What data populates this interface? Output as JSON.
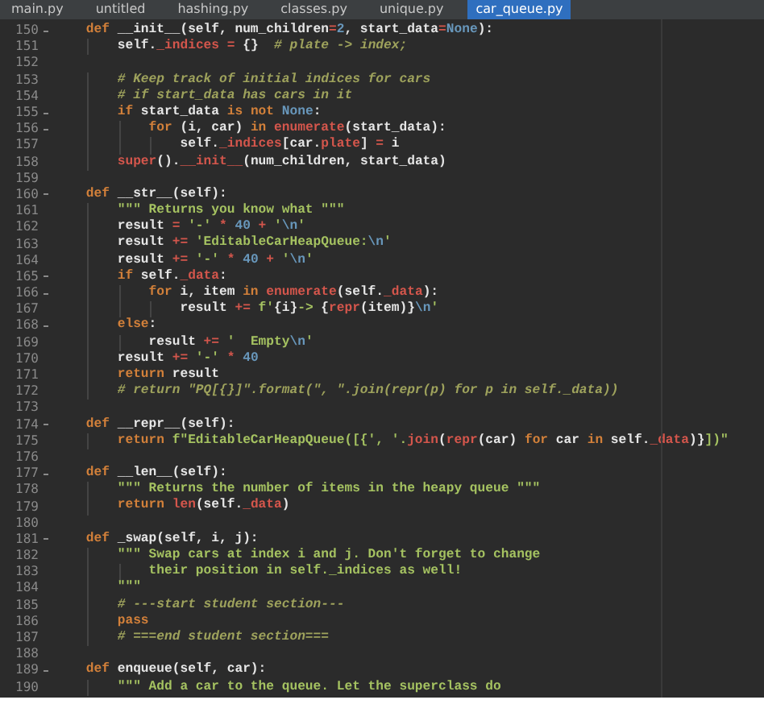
{
  "tabs": [
    {
      "label": "main.py",
      "selected": false
    },
    {
      "label": "untitled",
      "selected": false
    },
    {
      "label": "hashing.py",
      "selected": false
    },
    {
      "label": "classes.py",
      "selected": false
    },
    {
      "label": "unique.py",
      "selected": false
    },
    {
      "label": "car_queue.py",
      "selected": true
    }
  ],
  "lines": [
    {
      "n": "150",
      "fold": true,
      "tokens": [
        {
          "kind": "keyword",
          "text": "    def"
        },
        {
          "kind": "plain",
          "text": " __init__(self, num_children"
        },
        {
          "kind": "builtin",
          "text": "="
        },
        {
          "kind": "number",
          "text": "2"
        },
        {
          "kind": "plain",
          "text": ", start_data"
        },
        {
          "kind": "builtin",
          "text": "="
        },
        {
          "kind": "number",
          "text": "None"
        },
        {
          "kind": "plain",
          "text": "):"
        }
      ]
    },
    {
      "n": "151",
      "fold": false,
      "tokens": [
        {
          "kind": "plain",
          "text": "        self."
        },
        {
          "kind": "builtin",
          "text": "_indices = "
        },
        {
          "kind": "plain",
          "text": "{}  "
        },
        {
          "kind": "comment",
          "text": "# plate -> index;"
        }
      ]
    },
    {
      "n": "152",
      "fold": false
    },
    {
      "n": "153",
      "fold": false,
      "tokens": [
        {
          "kind": "comment",
          "text": "        # Keep track of initial indices for cars"
        }
      ]
    },
    {
      "n": "154",
      "fold": false,
      "tokens": [
        {
          "kind": "comment",
          "text": "        # if start_data has cars in it"
        }
      ]
    },
    {
      "n": "155",
      "fold": true,
      "tokens": [
        {
          "kind": "keyword",
          "text": "        if"
        },
        {
          "kind": "plain",
          "text": " start_data "
        },
        {
          "kind": "keyword",
          "text": "is not"
        },
        {
          "kind": "number",
          "text": " None"
        },
        {
          "kind": "plain",
          "text": ":"
        }
      ]
    },
    {
      "n": "156",
      "fold": true,
      "tokens": [
        {
          "kind": "keyword",
          "text": "            for"
        },
        {
          "kind": "plain",
          "text": " (i, car) "
        },
        {
          "kind": "keyword",
          "text": "in"
        },
        {
          "kind": "builtin",
          "text": " enumerate"
        },
        {
          "kind": "plain",
          "text": "(start_data):"
        }
      ]
    },
    {
      "n": "157",
      "fold": false,
      "tokens": [
        {
          "kind": "plain",
          "text": "                self."
        },
        {
          "kind": "builtin",
          "text": "_indices"
        },
        {
          "kind": "plain",
          "text": "[car."
        },
        {
          "kind": "builtin",
          "text": "plate"
        },
        {
          "kind": "plain",
          "text": "] "
        },
        {
          "kind": "builtin",
          "text": "="
        },
        {
          "kind": "plain",
          "text": " i"
        }
      ]
    },
    {
      "n": "158",
      "fold": false,
      "tokens": [
        {
          "kind": "builtin",
          "text": "        super"
        },
        {
          "kind": "plain",
          "text": "()."
        },
        {
          "kind": "builtin",
          "text": "__init__"
        },
        {
          "kind": "plain",
          "text": "(num_children, start_data)"
        }
      ]
    },
    {
      "n": "159",
      "fold": false
    },
    {
      "n": "160",
      "fold": true,
      "tokens": [
        {
          "kind": "keyword",
          "text": "    def"
        },
        {
          "kind": "plain",
          "text": " __str__(self):"
        }
      ]
    },
    {
      "n": "161",
      "fold": false,
      "tokens": [
        {
          "kind": "string",
          "text": "        \"\"\" Returns you know what \"\"\""
        }
      ]
    },
    {
      "n": "162",
      "fold": false,
      "tokens": [
        {
          "kind": "plain",
          "text": "        result "
        },
        {
          "kind": "builtin",
          "text": "="
        },
        {
          "kind": "string",
          "text": " '-'"
        },
        {
          "kind": "builtin",
          "text": " *"
        },
        {
          "kind": "number",
          "text": " 40"
        },
        {
          "kind": "builtin",
          "text": " +"
        },
        {
          "kind": "string",
          "text": " '"
        },
        {
          "kind": "number",
          "text": "\\n"
        },
        {
          "kind": "string",
          "text": "'"
        }
      ]
    },
    {
      "n": "163",
      "fold": false,
      "tokens": [
        {
          "kind": "plain",
          "text": "        result "
        },
        {
          "kind": "builtin",
          "text": "+="
        },
        {
          "kind": "string",
          "text": " 'EditableCarHeapQueue:"
        },
        {
          "kind": "number",
          "text": "\\n"
        },
        {
          "kind": "string",
          "text": "'"
        }
      ]
    },
    {
      "n": "164",
      "fold": false,
      "tokens": [
        {
          "kind": "plain",
          "text": "        result "
        },
        {
          "kind": "builtin",
          "text": "+="
        },
        {
          "kind": "string",
          "text": " '-'"
        },
        {
          "kind": "builtin",
          "text": " *"
        },
        {
          "kind": "number",
          "text": " 40"
        },
        {
          "kind": "builtin",
          "text": " +"
        },
        {
          "kind": "string",
          "text": " '"
        },
        {
          "kind": "number",
          "text": "\\n"
        },
        {
          "kind": "string",
          "text": "'"
        }
      ]
    },
    {
      "n": "165",
      "fold": true,
      "tokens": [
        {
          "kind": "keyword",
          "text": "        if"
        },
        {
          "kind": "plain",
          "text": " self."
        },
        {
          "kind": "builtin",
          "text": "_data"
        },
        {
          "kind": "plain",
          "text": ":"
        }
      ]
    },
    {
      "n": "166",
      "fold": true,
      "tokens": [
        {
          "kind": "keyword",
          "text": "            for"
        },
        {
          "kind": "plain",
          "text": " i, item "
        },
        {
          "kind": "keyword",
          "text": "in"
        },
        {
          "kind": "builtin",
          "text": " enumerate"
        },
        {
          "kind": "plain",
          "text": "(self."
        },
        {
          "kind": "builtin",
          "text": "_data"
        },
        {
          "kind": "plain",
          "text": "):"
        }
      ]
    },
    {
      "n": "167",
      "fold": false,
      "tokens": [
        {
          "kind": "plain",
          "text": "                result "
        },
        {
          "kind": "builtin",
          "text": "+="
        },
        {
          "kind": "string",
          "text": " f'"
        },
        {
          "kind": "plain",
          "text": "{i}"
        },
        {
          "kind": "string",
          "text": "-> "
        },
        {
          "kind": "plain",
          "text": "{"
        },
        {
          "kind": "builtin",
          "text": "repr"
        },
        {
          "kind": "plain",
          "text": "(item)}"
        },
        {
          "kind": "number",
          "text": "\\n"
        },
        {
          "kind": "string",
          "text": "'"
        }
      ]
    },
    {
      "n": "168",
      "fold": true,
      "tokens": [
        {
          "kind": "keyword",
          "text": "        else"
        },
        {
          "kind": "plain",
          "text": ":"
        }
      ]
    },
    {
      "n": "169",
      "fold": false,
      "tokens": [
        {
          "kind": "plain",
          "text": "            result "
        },
        {
          "kind": "builtin",
          "text": "+="
        },
        {
          "kind": "string",
          "text": " '  Empty"
        },
        {
          "kind": "number",
          "text": "\\n"
        },
        {
          "kind": "string",
          "text": "'"
        }
      ]
    },
    {
      "n": "170",
      "fold": false,
      "tokens": [
        {
          "kind": "plain",
          "text": "        result "
        },
        {
          "kind": "builtin",
          "text": "+="
        },
        {
          "kind": "string",
          "text": " '-'"
        },
        {
          "kind": "builtin",
          "text": " *"
        },
        {
          "kind": "number",
          "text": " 40"
        }
      ]
    },
    {
      "n": "171",
      "fold": false,
      "tokens": [
        {
          "kind": "keyword",
          "text": "        return"
        },
        {
          "kind": "plain",
          "text": " result"
        }
      ]
    },
    {
      "n": "172",
      "fold": false,
      "tokens": [
        {
          "kind": "comment",
          "text": "        # return \"PQ[{}]\".format(\", \".join(repr(p) for p in self._data))"
        }
      ]
    },
    {
      "n": "173",
      "fold": false
    },
    {
      "n": "174",
      "fold": true,
      "tokens": [
        {
          "kind": "keyword",
          "text": "    def"
        },
        {
          "kind": "plain",
          "text": " __repr__(self):"
        }
      ]
    },
    {
      "n": "175",
      "fold": false,
      "tokens": [
        {
          "kind": "keyword",
          "text": "        return"
        },
        {
          "kind": "string",
          "text": " f\"EditableCarHeapQueue([{', '."
        },
        {
          "kind": "builtin",
          "text": "join"
        },
        {
          "kind": "plain",
          "text": "("
        },
        {
          "kind": "builtin",
          "text": "repr"
        },
        {
          "kind": "plain",
          "text": "(car) "
        },
        {
          "kind": "keyword",
          "text": "for"
        },
        {
          "kind": "plain",
          "text": " car "
        },
        {
          "kind": "keyword",
          "text": "in"
        },
        {
          "kind": "plain",
          "text": " self."
        },
        {
          "kind": "builtin",
          "text": "_data"
        },
        {
          "kind": "plain",
          "text": ")}"
        },
        {
          "kind": "string",
          "text": "])\""
        }
      ]
    },
    {
      "n": "176",
      "fold": false
    },
    {
      "n": "177",
      "fold": true,
      "tokens": [
        {
          "kind": "keyword",
          "text": "    def"
        },
        {
          "kind": "plain",
          "text": " __len__(self):"
        }
      ]
    },
    {
      "n": "178",
      "fold": false,
      "tokens": [
        {
          "kind": "string",
          "text": "        \"\"\" Returns the number of items in the heapy queue \"\"\""
        }
      ]
    },
    {
      "n": "179",
      "fold": false,
      "tokens": [
        {
          "kind": "keyword",
          "text": "        return"
        },
        {
          "kind": "builtin",
          "text": " len"
        },
        {
          "kind": "plain",
          "text": "(self."
        },
        {
          "kind": "builtin",
          "text": "_data"
        },
        {
          "kind": "plain",
          "text": ")"
        }
      ]
    },
    {
      "n": "180",
      "fold": false
    },
    {
      "n": "181",
      "fold": true,
      "tokens": [
        {
          "kind": "keyword",
          "text": "    def"
        },
        {
          "kind": "plain",
          "text": " _swap(self, i, j):"
        }
      ]
    },
    {
      "n": "182",
      "fold": false,
      "tokens": [
        {
          "kind": "string",
          "text": "        \"\"\" Swap cars at index i and j. Don't forget to change"
        }
      ]
    },
    {
      "n": "183",
      "fold": false,
      "tokens": [
        {
          "kind": "string",
          "text": "            their position in self._indices as well!"
        }
      ]
    },
    {
      "n": "184",
      "fold": false,
      "tokens": [
        {
          "kind": "string",
          "text": "        \"\"\""
        }
      ]
    },
    {
      "n": "185",
      "fold": false,
      "tokens": [
        {
          "kind": "comment",
          "text": "        # ---start student section---"
        }
      ]
    },
    {
      "n": "186",
      "fold": false,
      "tokens": [
        {
          "kind": "keyword",
          "text": "        pass"
        }
      ]
    },
    {
      "n": "187",
      "fold": false,
      "tokens": [
        {
          "kind": "comment",
          "text": "        # ===end student section==="
        }
      ]
    },
    {
      "n": "188",
      "fold": false
    },
    {
      "n": "189",
      "fold": true,
      "tokens": [
        {
          "kind": "keyword",
          "text": "    def"
        },
        {
          "kind": "plain",
          "text": " enqueue(self, car):"
        }
      ]
    },
    {
      "n": "190",
      "fold": false,
      "tokens": [
        {
          "kind": "string",
          "text": "        \"\"\" Add a car to the queue. Let the superclass do"
        }
      ]
    }
  ]
}
